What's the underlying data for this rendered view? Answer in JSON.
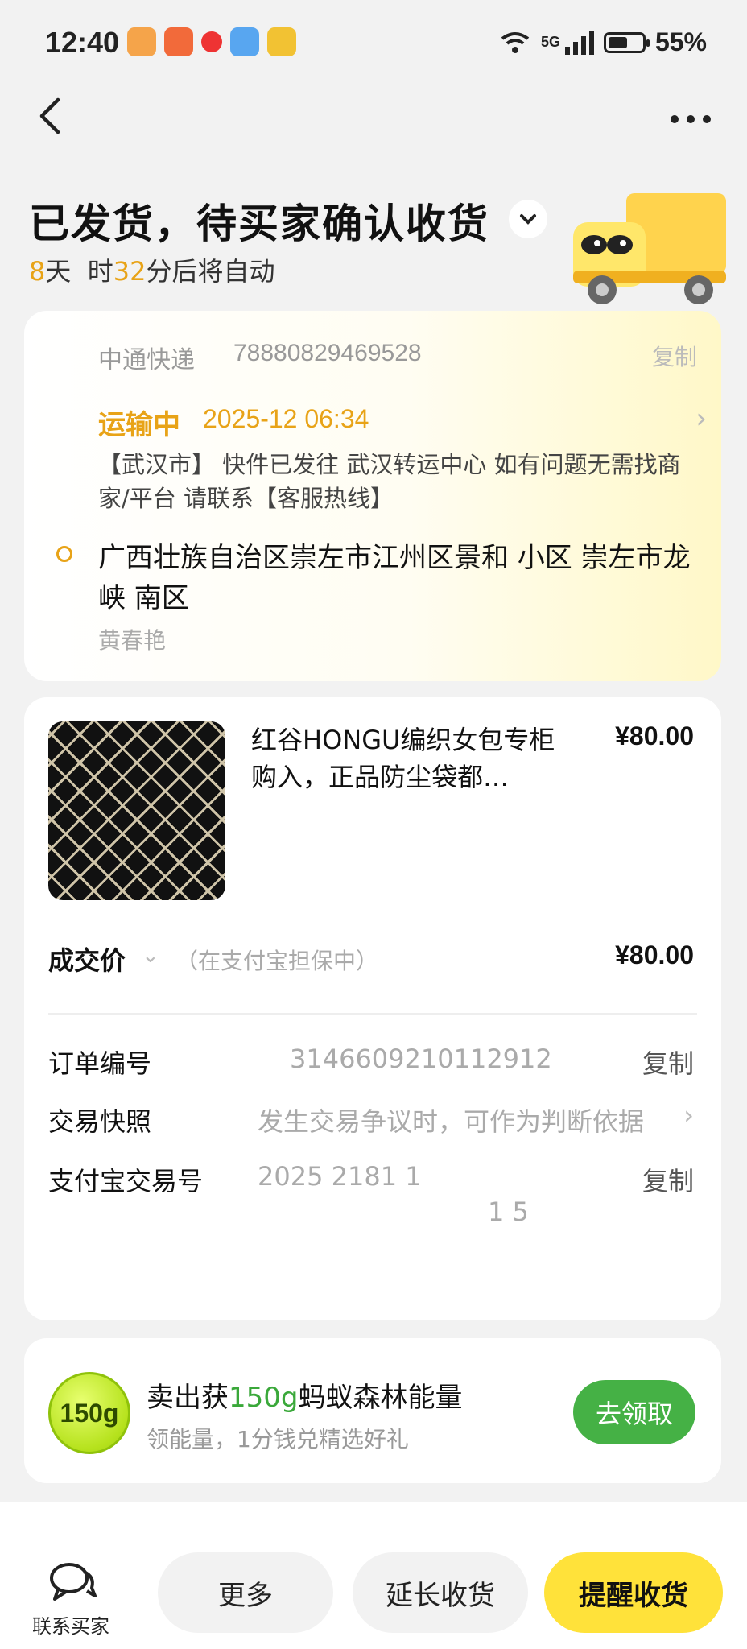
{
  "status_bar": {
    "time": "12:40",
    "network": "5G",
    "battery": "55%",
    "battery_level": 55
  },
  "header": {
    "title": "已发货，待买家确认收货",
    "countdown_days": "8",
    "countdown_unit_day": "天",
    "countdown_unit_hour": "时",
    "countdown_minutes": "32",
    "countdown_suffix": "分后将自动"
  },
  "logistics": {
    "courier": "中通快递",
    "tracking_no": "78880829469528",
    "copy_label": "复制",
    "status": "运输中",
    "date": "2025-12 06:34",
    "detail": "【武汉市】 快件已发往 武汉转运中心 如有问题无需找商家/平台 请联系【客服热线】",
    "address": "广西壮族自治区崇左市江州区景和 小区 崇左市龙峡 南区",
    "consignee": "黄春艳"
  },
  "order": {
    "product_name": "红谷HONGU编织女包专柜购入，正品防尘袋都…",
    "price": "¥80.00",
    "deal_label": "成交价",
    "deal_note": "（在支付宝担保中）",
    "deal_price": "¥80.00",
    "rows": [
      {
        "label": "订单编号",
        "value": "3146609210112912",
        "action": "复制"
      },
      {
        "label": "交易快照",
        "value": "发生交易争议时，可作为判断依据",
        "action": "›"
      },
      {
        "label": "支付宝交易号",
        "value": "2025 2181 1",
        "value2": "1 5",
        "action": "复制"
      }
    ]
  },
  "energy": {
    "badge": "150g",
    "title_prefix": "卖出获",
    "title_amount": "150g",
    "title_suffix": "蚂蚁森林能量",
    "subtitle": "领能量，1分钱兑精选好礼",
    "button": "去领取"
  },
  "bottom_bar": {
    "contact_label": "联系买家",
    "more_label": "更多",
    "extend_label": "延长收货",
    "remind_label": "提醒收货"
  },
  "colors": {
    "accent_yellow": "#ffe23a",
    "orange": "#e8a317",
    "green": "#45b145"
  }
}
